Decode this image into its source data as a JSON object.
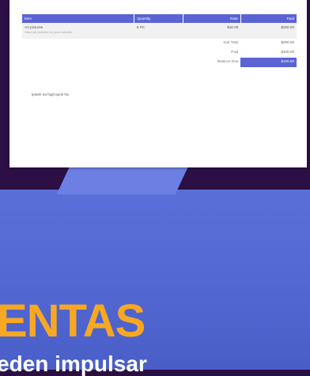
{
  "invoice": {
    "columns": {
      "item": "Item",
      "quantity": "Quantity",
      "rate": "Rate",
      "total": "Total"
    },
    "line": {
      "name": "Art pictures",
      "description": "Hand art pictures for your website.",
      "quantity": "5 PC",
      "rate": "$40.00",
      "total": "$200.00"
    },
    "summary": [
      {
        "label": "Sub Total",
        "value": "$200.00"
      },
      {
        "label": "Paid",
        "value": "$100.00"
      },
      {
        "label": "Balance Due",
        "value": "$100.00"
      }
    ],
    "note": "Ipsam ea fugit quos hic."
  },
  "banner": {
    "headline": "ENTAS",
    "subline": "eden impulsar"
  },
  "colors": {
    "accent": "#5b63d3",
    "headline": "#f7a823",
    "background_top": "#2b0f45",
    "background_bottom": "#5569d4"
  }
}
